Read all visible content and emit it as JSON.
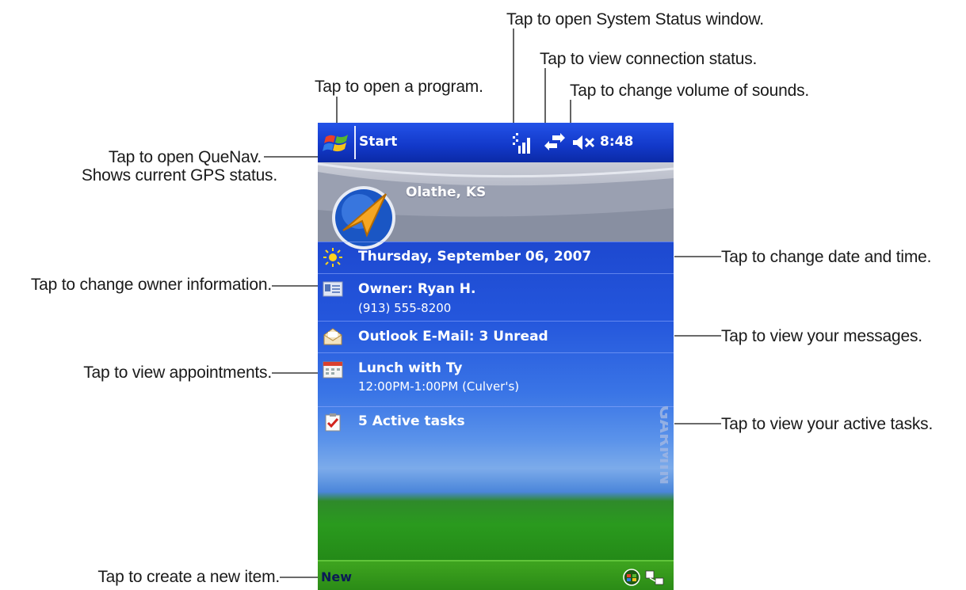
{
  "callouts": {
    "system_status": "Tap to open System Status window.",
    "connection": "Tap to view connection status.",
    "open_program": "Tap to open a program.",
    "volume": "Tap to change volume of sounds.",
    "quenav_line1": "Tap to open QueNav.",
    "quenav_line2": "Shows current GPS status.",
    "owner": "Tap to change owner information.",
    "date_time": "Tap to change date and time.",
    "messages": "Tap to view your messages.",
    "appointments": "Tap to view appointments.",
    "tasks": "Tap to view your active tasks.",
    "new_item": "Tap to create a new item."
  },
  "taskbar": {
    "start_label": "Start",
    "time": "8:48",
    "icons": [
      "windows-flag-icon",
      "signal-icon",
      "connection-icon",
      "volume-muted-icon"
    ]
  },
  "gps": {
    "location": "Olathe, KS"
  },
  "today": {
    "date": "Thursday, September 06, 2007",
    "owner_name": "Owner: Ryan H.",
    "owner_phone": "(913) 555-8200",
    "email": "Outlook E-Mail: 3 Unread",
    "appointment_title": "Lunch with Ty",
    "appointment_time": "12:00PM-1:00PM (Culver's)",
    "tasks": "5 Active tasks"
  },
  "brand": {
    "logo_text": "GARMIN"
  },
  "menubar": {
    "new_label": "New",
    "icons": [
      "input-panel-icon",
      "sync-icon"
    ]
  },
  "colors": {
    "taskbar": "#1238c8",
    "screen_sky": "#2456dc",
    "menubar": "#2a8a16",
    "callout_text": "#1a1a1a"
  }
}
